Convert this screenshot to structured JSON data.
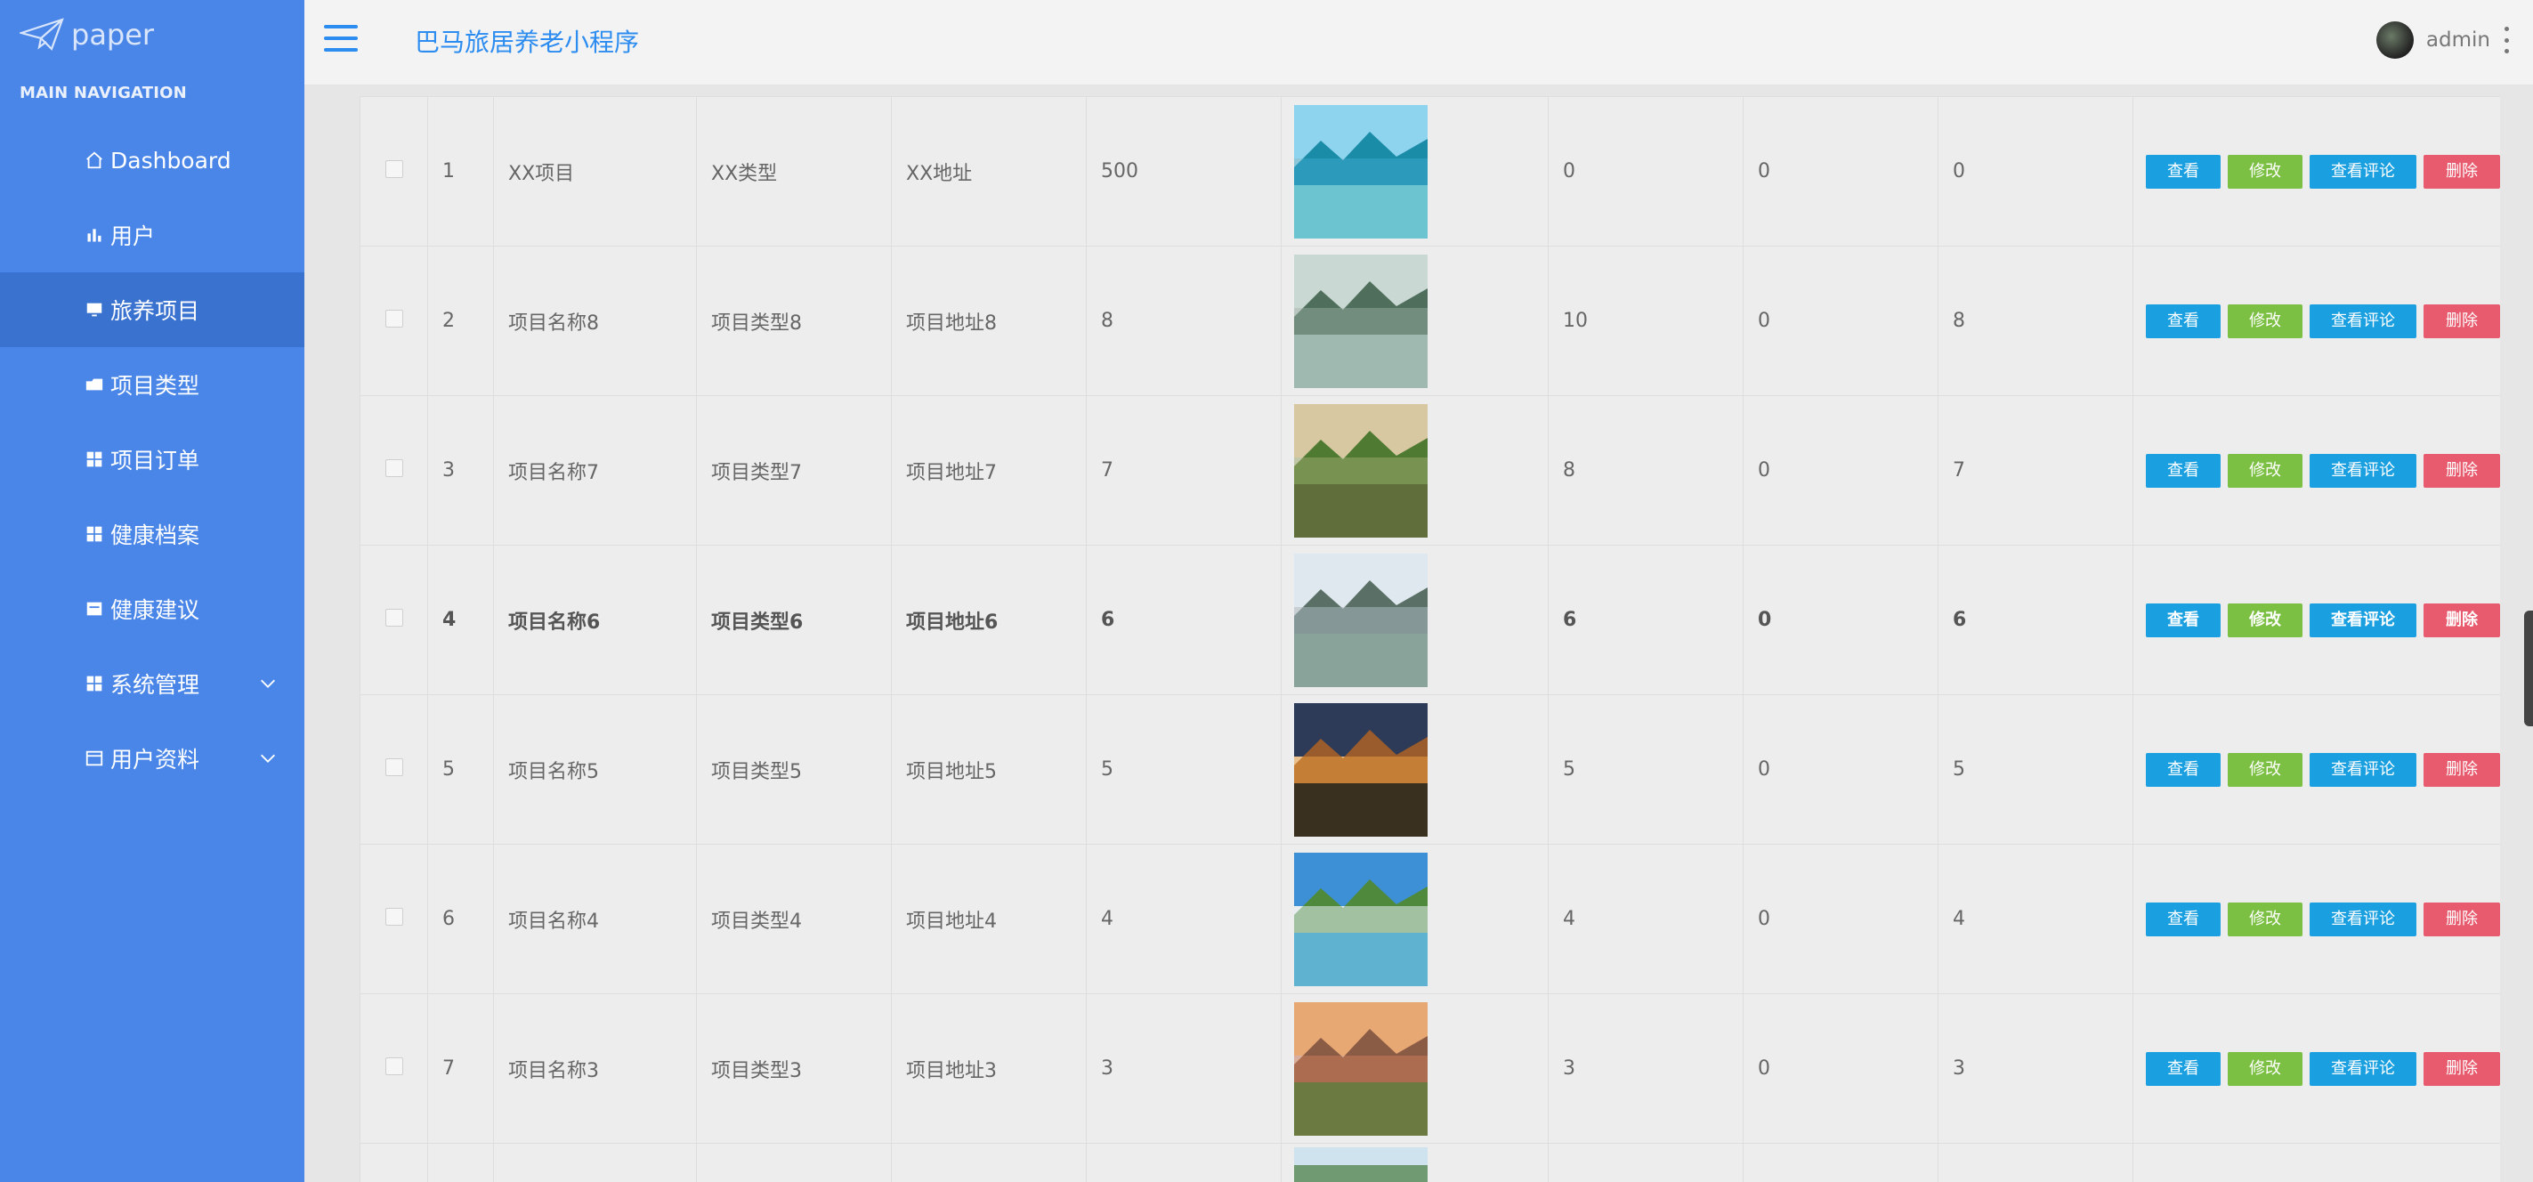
{
  "brand": {
    "name": "paper",
    "icon": "paper-plane-icon"
  },
  "sidebar": {
    "header": "MAIN NAVIGATION",
    "items": [
      {
        "label": "Dashboard",
        "icon": "home-icon"
      },
      {
        "label": "用户",
        "icon": "bar-chart-icon"
      },
      {
        "label": "旅养项目",
        "icon": "monitor-icon",
        "active": true
      },
      {
        "label": "项目类型",
        "icon": "folder-icon"
      },
      {
        "label": "项目订单",
        "icon": "grid-icon"
      },
      {
        "label": "健康档案",
        "icon": "grid-icon"
      },
      {
        "label": "健康建议",
        "icon": "card-icon"
      },
      {
        "label": "系统管理",
        "icon": "grid-icon",
        "expandable": true
      },
      {
        "label": "用户资料",
        "icon": "window-icon",
        "expandable": true
      }
    ]
  },
  "header": {
    "title": "巴马旅居养老小程序",
    "user": "admin"
  },
  "buttons": {
    "view": "查看",
    "edit": "修改",
    "review": "查看评论",
    "delete": "删除"
  },
  "colors": {
    "sidebar": "#4a86e8",
    "accent": "#2d8cf0",
    "view": "#1aa0e0",
    "edit": "#7bc043",
    "delete": "#e85a6d"
  },
  "rows": [
    {
      "idx": "1",
      "name": "XX项目",
      "type": "XX类型",
      "addr": "XX地址",
      "num": "500",
      "c1": "0",
      "c2": "0",
      "c3": "0",
      "image": "lake-islands"
    },
    {
      "idx": "2",
      "name": "项目名称8",
      "type": "项目类型8",
      "addr": "项目地址8",
      "num": "8",
      "c1": "10",
      "c2": "0",
      "c3": "8",
      "image": "misty-mountains"
    },
    {
      "idx": "3",
      "name": "项目名称7",
      "type": "项目类型7",
      "addr": "项目地址7",
      "num": "7",
      "c1": "8",
      "c2": "0",
      "c3": "7",
      "image": "boardwalk-sunset"
    },
    {
      "idx": "4",
      "name": "项目名称6",
      "type": "项目类型6",
      "addr": "项目地址6",
      "num": "6",
      "c1": "6",
      "c2": "0",
      "c3": "6",
      "image": "village-pond",
      "hover": true
    },
    {
      "idx": "5",
      "name": "项目名称5",
      "type": "项目类型5",
      "addr": "项目地址5",
      "num": "5",
      "c1": "5",
      "c2": "0",
      "c3": "5",
      "image": "orange-sunset"
    },
    {
      "idx": "6",
      "name": "项目名称4",
      "type": "项目类型4",
      "addr": "项目地址4",
      "num": "4",
      "c1": "4",
      "c2": "0",
      "c3": "4",
      "image": "blue-lake-valley"
    },
    {
      "idx": "7",
      "name": "项目名称3",
      "type": "项目类型3",
      "addr": "项目地址3",
      "num": "3",
      "c1": "3",
      "c2": "0",
      "c3": "3",
      "image": "house-sunset"
    }
  ]
}
